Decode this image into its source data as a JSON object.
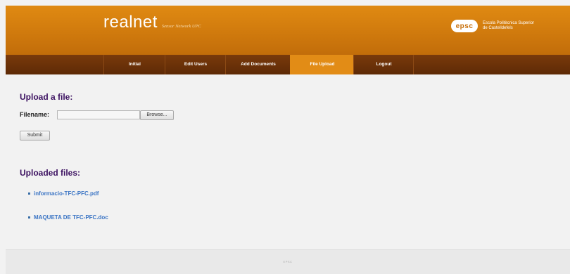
{
  "header": {
    "brand_name": "realnet",
    "brand_subtitle": "Sensor Network UPC",
    "partner_logo": "epsc",
    "partner_name": "Escola Politècnica Superior\nde Castelldefels"
  },
  "nav": {
    "items": [
      {
        "label": "Initial"
      },
      {
        "label": "Edit Users"
      },
      {
        "label": "Add Documents"
      },
      {
        "label": "File Upload",
        "active": true
      },
      {
        "label": "Logout"
      }
    ]
  },
  "upload": {
    "title": "Upload a file:",
    "filename_label": "Filename:",
    "file_value": "",
    "browse_label": "Browse...",
    "submit_label": "Submit"
  },
  "uploaded": {
    "title": "Uploaded files:",
    "files": [
      {
        "name": "informacio-TFC-PFC.pdf"
      },
      {
        "name": "MAQUETA DE TFC-PFC.doc"
      }
    ]
  },
  "footer": {
    "text": "EPSC"
  },
  "colors": {
    "header_orange": "#d07a0d",
    "nav_brown": "#6b3208",
    "active_tab": "#e28c16",
    "title_purple": "#3b1060",
    "link_blue": "#3a74c4"
  }
}
